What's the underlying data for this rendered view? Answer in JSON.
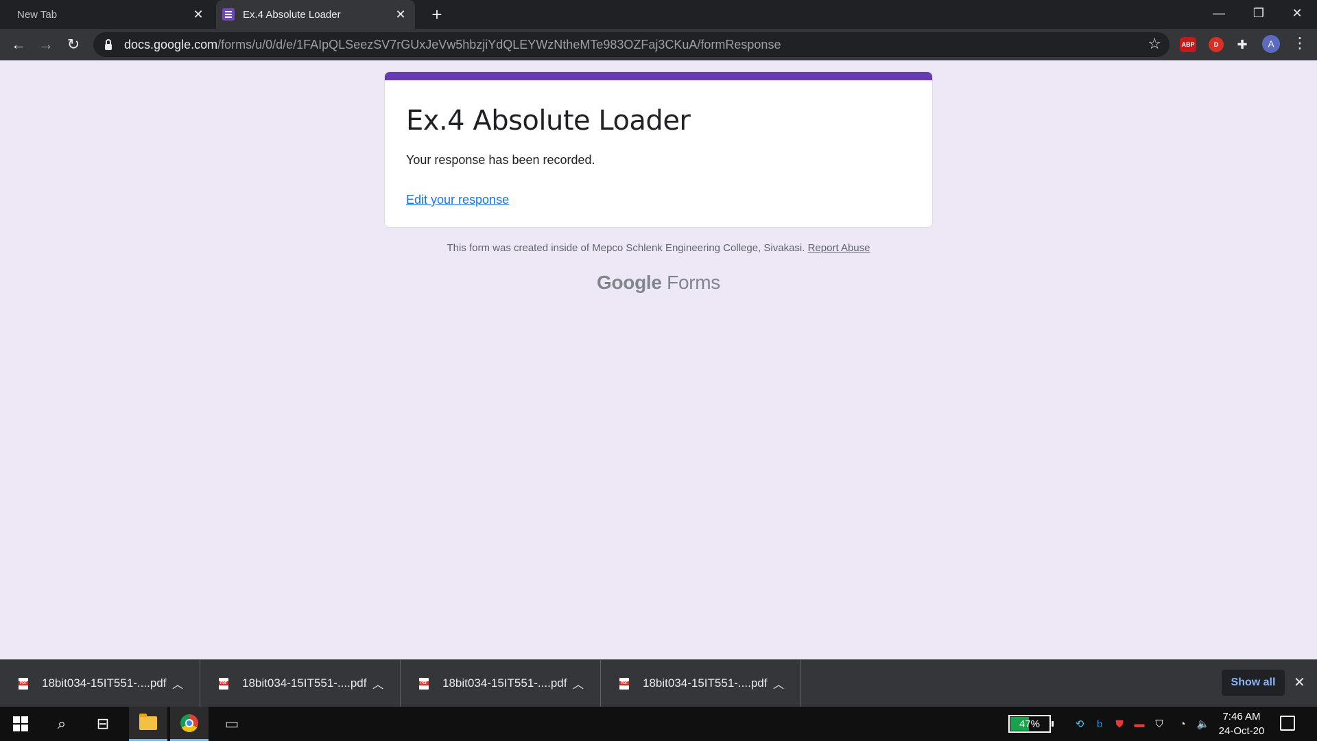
{
  "browser": {
    "tabs": [
      {
        "title": "New Tab",
        "active": false
      },
      {
        "title": "Ex.4 Absolute Loader",
        "active": true
      }
    ],
    "url_host": "docs.google.com",
    "url_path": "/forms/u/0/d/e/1FAIpQLSeezSV7rGUxJeVw5hbzjiYdQLEYWzNtheMTe983OZFaj3CKuA/formResponse",
    "extensions": [
      {
        "label": "ABP",
        "color": "#c41a1a",
        "icon": "adblock-plus-icon"
      },
      {
        "label": "D",
        "color": "#d93025",
        "icon": "red-d-extension-icon"
      }
    ],
    "avatar_letter": "A"
  },
  "form": {
    "title": "Ex.4 Absolute Loader",
    "confirmation": "Your response has been recorded.",
    "edit_link": "Edit your response",
    "accent_color": "#673ab7",
    "footnote": "This form was created inside of Mepco Schlenk Engineering College, Sivakasi.",
    "report_abuse": "Report Abuse",
    "brand_google": "Google",
    "brand_forms": "Forms"
  },
  "downloads": {
    "items": [
      {
        "filename": "18bit034-15IT551-....pdf"
      },
      {
        "filename": "18bit034-15IT551-....pdf"
      },
      {
        "filename": "18bit034-15IT551-....pdf"
      },
      {
        "filename": "18bit034-15IT551-....pdf"
      }
    ],
    "show_all": "Show all"
  },
  "taskbar": {
    "battery_percent": "47%",
    "battery_level": 0.47,
    "time": "7:46 AM",
    "date": "24-Oct-20"
  }
}
